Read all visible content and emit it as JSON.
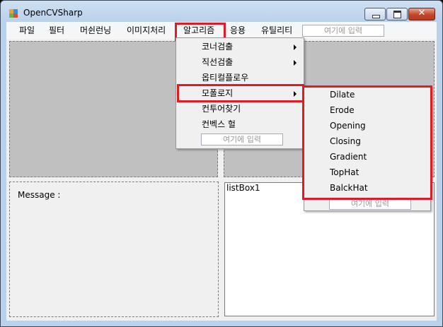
{
  "window": {
    "title": "OpenCVSharp",
    "close_glyph": "✕"
  },
  "menu": {
    "items": [
      {
        "label": "파일"
      },
      {
        "label": "필터"
      },
      {
        "label": "머쉰런닝"
      },
      {
        "label": "이미지처리"
      },
      {
        "label": "알고리즘"
      },
      {
        "label": "응용"
      },
      {
        "label": "유틸리티"
      }
    ],
    "input_placeholder": "여기에 입력"
  },
  "algorithm_menu": {
    "items": [
      {
        "label": "코너검출",
        "submenu": true
      },
      {
        "label": "직선검출",
        "submenu": true
      },
      {
        "label": "옵티컬플로우",
        "submenu": false
      },
      {
        "label": "모폴로지",
        "submenu": true
      },
      {
        "label": "컨투어찾기",
        "submenu": false
      },
      {
        "label": "컨벡스 헐",
        "submenu": false
      }
    ],
    "input_placeholder": "여기에 입력"
  },
  "morphology_menu": {
    "items": [
      "Dilate",
      "Erode",
      "Opening",
      "Closing",
      "Gradient",
      "TopHat",
      "BalckHat"
    ],
    "input_placeholder": "여기에 입력"
  },
  "message_label": "Message :",
  "listbox_label": "listBox1",
  "colors": {
    "highlight": "#e01b24",
    "picture": "#c0c0c0"
  }
}
